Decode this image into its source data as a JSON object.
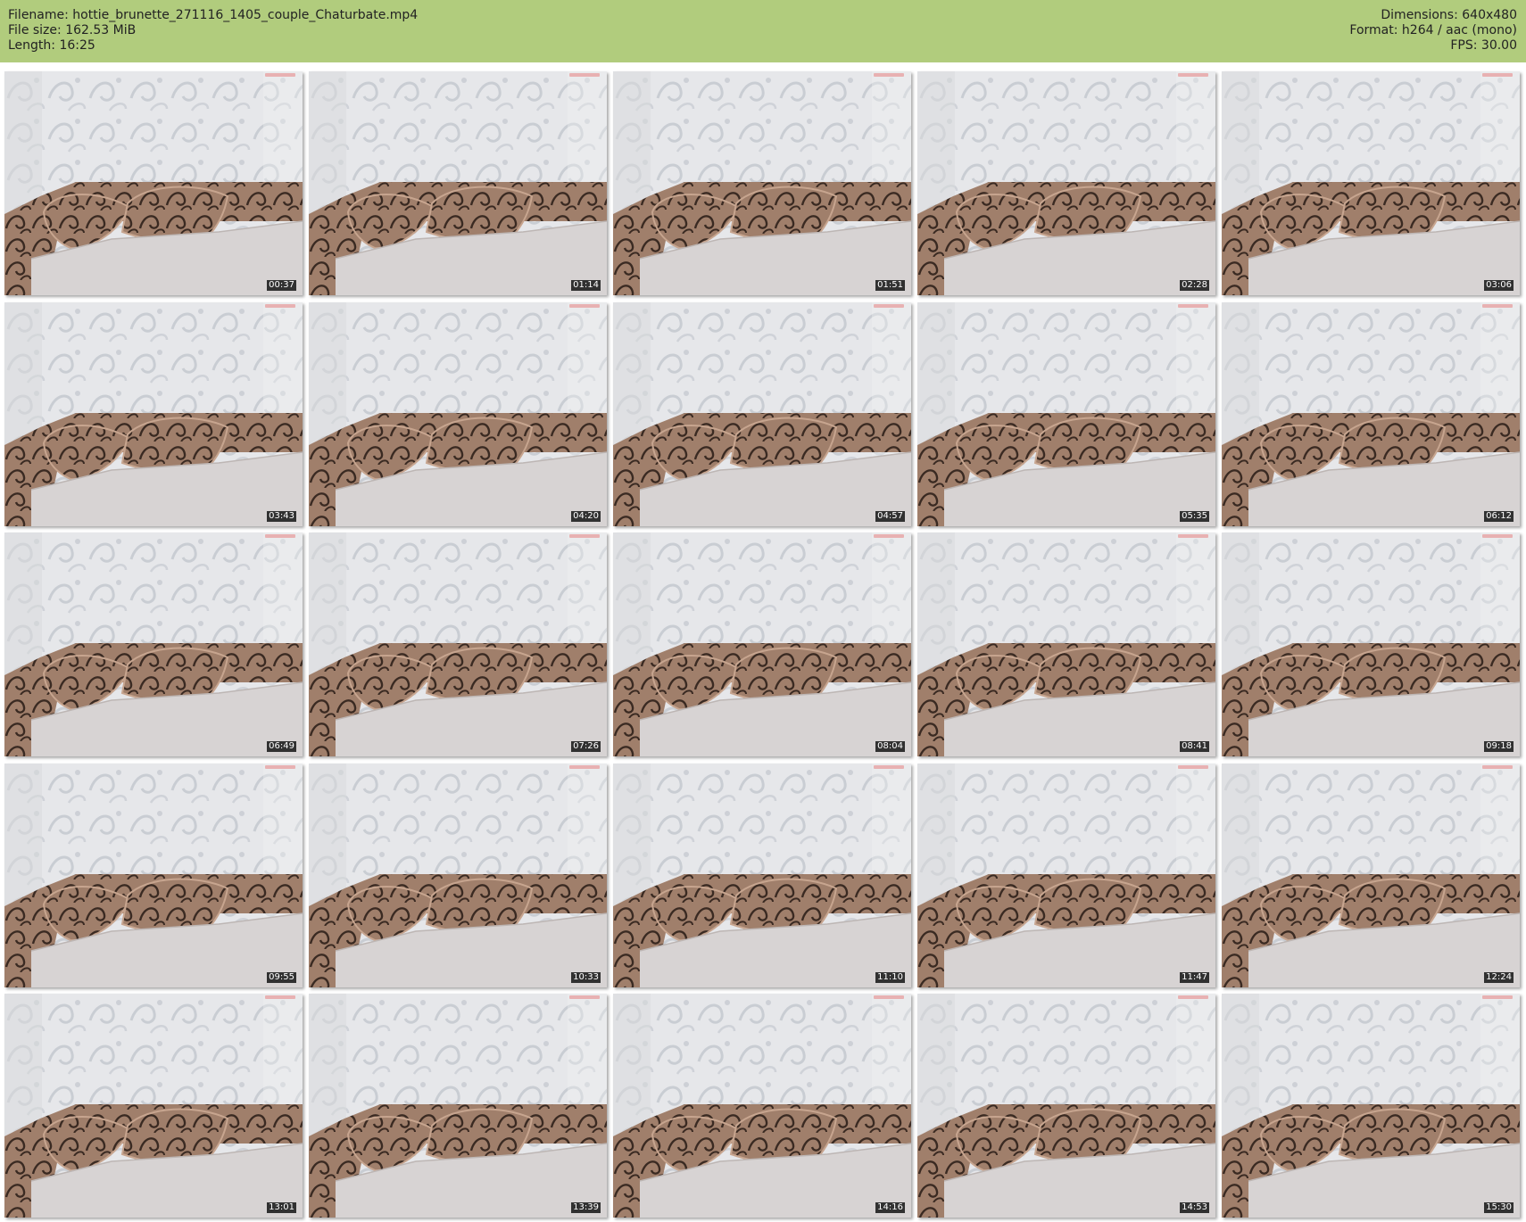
{
  "header": {
    "filename_label": "Filename: hottie_brunette_271116_1405_couple_Chaturbate.mp4",
    "filesize_label": "File size: 162.53 MiB",
    "length_label": "Length: 16:25",
    "dimensions_label": "Dimensions: 640x480",
    "format_label": "Format: h264 / aac (mono)",
    "fps_label": "FPS: 30.00"
  },
  "colors": {
    "header_bg": "#b1cc7d",
    "wall": "#e9eaec",
    "sofa": "#9c7b68",
    "sofa_pattern": "#3a2a22",
    "seat": "#d7d3d3",
    "timestamp_bg": "#141414"
  },
  "thumbnails": [
    {
      "time": "00:37"
    },
    {
      "time": "01:14"
    },
    {
      "time": "01:51"
    },
    {
      "time": "02:28"
    },
    {
      "time": "03:06"
    },
    {
      "time": "03:43"
    },
    {
      "time": "04:20"
    },
    {
      "time": "04:57"
    },
    {
      "time": "05:35"
    },
    {
      "time": "06:12"
    },
    {
      "time": "06:49"
    },
    {
      "time": "07:26"
    },
    {
      "time": "08:04"
    },
    {
      "time": "08:41"
    },
    {
      "time": "09:18"
    },
    {
      "time": "09:55"
    },
    {
      "time": "10:33"
    },
    {
      "time": "11:10"
    },
    {
      "time": "11:47"
    },
    {
      "time": "12:24"
    },
    {
      "time": "13:01"
    },
    {
      "time": "13:39"
    },
    {
      "time": "14:16"
    },
    {
      "time": "14:53"
    },
    {
      "time": "15:30"
    }
  ]
}
